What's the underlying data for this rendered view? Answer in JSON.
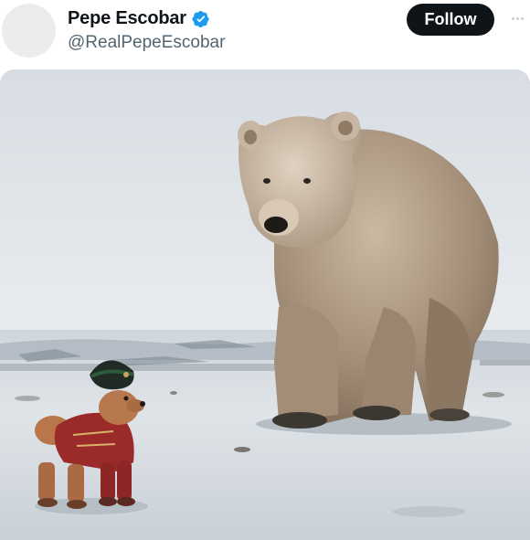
{
  "tweet": {
    "author": {
      "display_name": "Pepe Escobar",
      "handle": "@RealPepeEscobar",
      "verified": true,
      "avatar_icon": "default-avatar-icon"
    },
    "follow_label": "Follow",
    "more_icon": "more-options-icon",
    "media": {
      "type": "image",
      "description_icon": "photo-media-icon"
    }
  },
  "colors": {
    "follow_bg": "#0f1419",
    "verified": "#1d9bf0",
    "handle": "#536471"
  }
}
